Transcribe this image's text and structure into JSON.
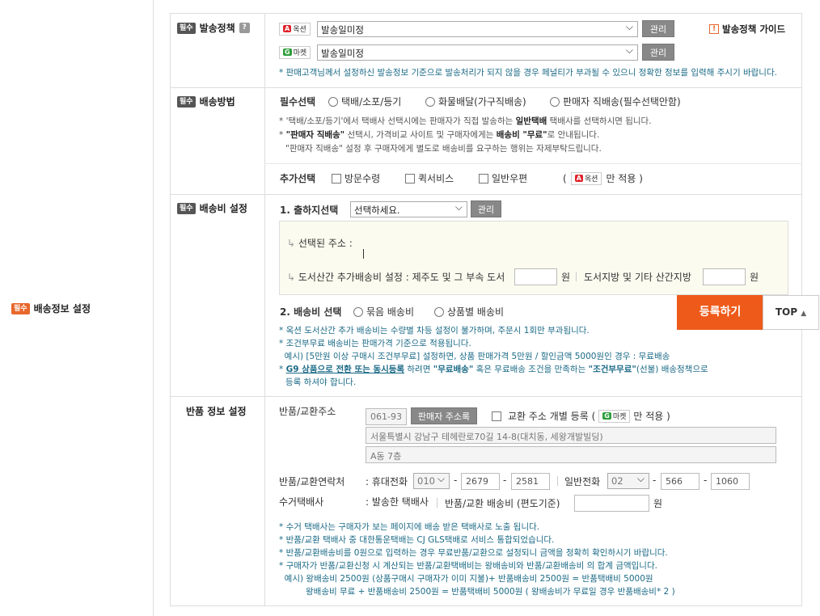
{
  "section": {
    "badge": "필수",
    "title": "배송정보 설정"
  },
  "policy": {
    "badge": "필수",
    "title": "발송정책",
    "help": "?",
    "auction_logo": "옥션",
    "gmarket_logo": "마켓",
    "auction_select": "발송일미정",
    "gmarket_select": "발송일미정",
    "manage1": "관리",
    "manage2": "관리",
    "guide_icon": "!",
    "guide": "발송정책 가이드",
    "note": "* 판매고객님께서 설정하신 발송정보 기준으로 발송처리가 되지 않을 경우 페널티가 부과될 수 있으니 정확한 정보를 입력해 주시기 바랍니다."
  },
  "method": {
    "badge": "필수",
    "title": "배송방법",
    "required_label": "필수선택",
    "options": [
      "택배/소포/등기",
      "화물배달(가구직배송)",
      "판매자 직배송(필수선택안함)"
    ],
    "note1": "* '택배/소포/등기'에서 택배사 선택시에는 판매자가 직접 발송하는",
    "note1_bold": "일반택배",
    "note1_end": "택배사를 선택하시면 됩니다.",
    "note2_a": "* ",
    "note2_bold": "\"판매자 직배송\"",
    "note2_b": " 선택시, 가격비교 사이트 및 구매자에게는 ",
    "note2_bold2": "배송비 \"무료\"",
    "note2_c": "로 안내됩니다.",
    "note3": "\"판매자 직배송\" 설정 후 구매자에게 별도로 배송비를 요구하는 행위는 자제부탁드립니다.",
    "extra_label": "추가선택",
    "extras": [
      "방문수령",
      "퀵서비스",
      "일반우편"
    ],
    "extra_note_a": "(",
    "extra_logo": "옥션",
    "extra_note_b": "만 적용 )"
  },
  "fee": {
    "badge": "필수",
    "title": "배송비 설정",
    "origin_label": "1. 출하지선택",
    "origin_select": "선택하세요.",
    "manage": "관리",
    "selected_addr": "선택된 주소 :",
    "island_label": "도서산간 추가배송비 설정 : 제주도 및 그 부속 도서",
    "won1": "원",
    "other_label": "도서지방 및 기타 산간지방",
    "won2": "원",
    "fee_label": "2. 배송비 선택",
    "fee_options": [
      "묶음 배송비",
      "상품별 배송비"
    ],
    "notes": [
      "* 옥션 도서산간 추가 배송비는 수량별 차등 설정이 불가하며, 주문시 1회만 부과됩니다.",
      "* 조건부무료 배송비는 판매가격 기준으로 적용됩니다.",
      "  예시) [5만원 이상 구매시 조건부무료] 설정하면, 상품 판매가격 5만원 / 할인금액 5000원인 경우 : 무료배송"
    ],
    "g9_a": "* ",
    "g9_link": "G9 상품으로 전환 또는 동시등록",
    "g9_b": " 하려면 ",
    "g9_bold": "\"무료배송\"",
    "g9_c": " 혹은 무료배송 조건을 만족하는 ",
    "g9_bold2": "\"조건부무료\"",
    "g9_d": "(선불) 배송정책으로",
    "g9_e": "등록 하셔야 합니다."
  },
  "return": {
    "title": "반품 정보 설정",
    "addr_label": "반품/교환주소",
    "zip": "061-93",
    "seller_addr_btn": "판매자 주소록",
    "individual": "교환 주소 개별 등록 (",
    "individual_logo": "마켓",
    "individual_end": "만 적용 )",
    "addr1": "서울특별시 강남구 테헤란로70길 14-8(대치동, 세왕개발빌딩)",
    "addr2": "A동 7층",
    "contact_label": "반품/교환연락처",
    "mobile_label": ": 휴대전화",
    "mobile": [
      "010",
      "2679",
      "2581"
    ],
    "phone_label": "일반전화",
    "phone": [
      "02",
      "566",
      "1060"
    ],
    "carrier_label": "수거택배사",
    "carrier_value": ": 발송한 택배사",
    "return_fee_label": "반품/교환 배송비 (편도기준)",
    "won": "원",
    "notes": [
      "* 수거 택배사는 구매자가 보는 페이지에 배송 받은 택배사로 노출 됩니다.",
      "* 반품/교환 택배사 중 대한통운택배는 CJ GLS택배로 서비스 통합되었습니다.",
      "* 반품/교환배송비를 0원으로 입력하는 경우 무료반품/교환으로 설정되니 금액을 정확히 확인하시기 바랍니다.",
      "* 구매자가 반품/교환신청 시 계산되는 반품/교환택배비는 왕배송비와 반품/교환배송비 의 합계 금액입니다.",
      "  예시) 왕배송비 2500원 (상품구매시 구매자가 이미 지불)+ 반품배송비 2500원 = 반품택배비 5000원",
      "왕배송비 무료 + 반품배송비 2500원 = 반품택배비 5000원 ( 왕배송비가 무료일 경우 반품배송비* 2 )"
    ]
  },
  "floating": {
    "register": "등록하기",
    "top": "TOP"
  }
}
